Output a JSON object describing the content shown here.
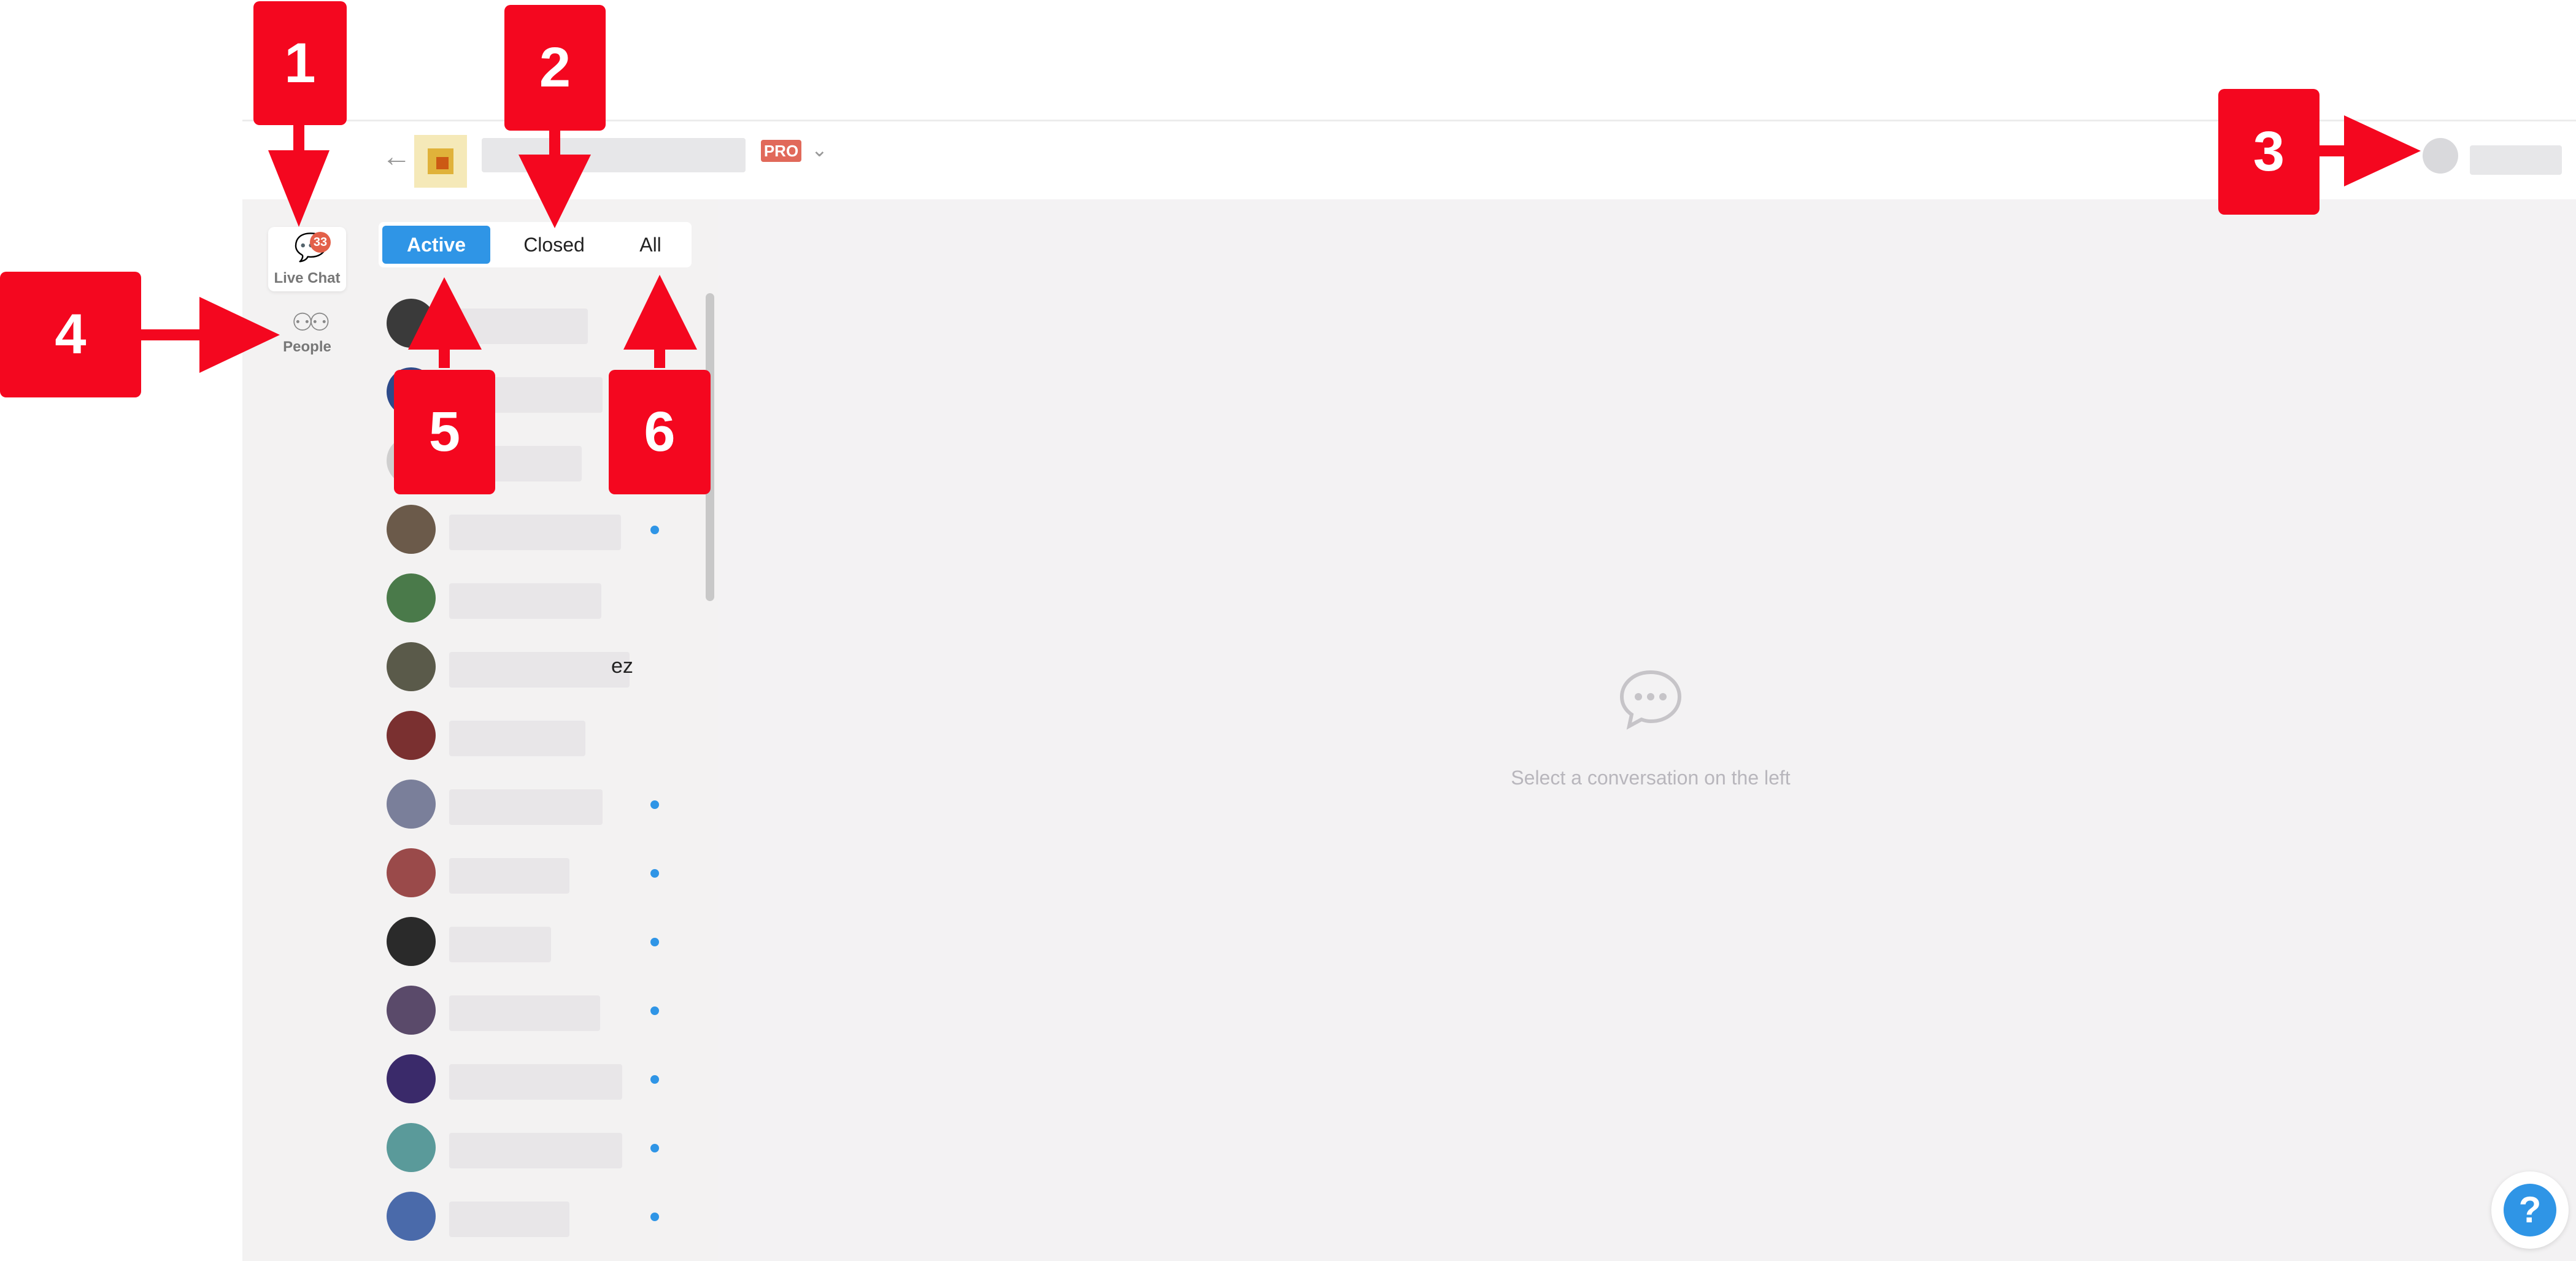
{
  "header": {
    "pro_badge": "PRO"
  },
  "nav": {
    "live_chat_label": "Live Chat",
    "live_chat_badge": "33",
    "people_label": "People"
  },
  "tabs": {
    "active": "Active",
    "closed": "Closed",
    "all": "All"
  },
  "conversations": [
    {
      "unread": false,
      "suffix": ""
    },
    {
      "unread": false,
      "suffix": ""
    },
    {
      "unread": false,
      "suffix": ""
    },
    {
      "unread": true,
      "suffix": ""
    },
    {
      "unread": false,
      "suffix": ""
    },
    {
      "unread": false,
      "suffix": "ez"
    },
    {
      "unread": false,
      "suffix": ""
    },
    {
      "unread": true,
      "suffix": ""
    },
    {
      "unread": true,
      "suffix": ""
    },
    {
      "unread": true,
      "suffix": ""
    },
    {
      "unread": true,
      "suffix": ""
    },
    {
      "unread": true,
      "suffix": ""
    },
    {
      "unread": true,
      "suffix": ""
    },
    {
      "unread": true,
      "suffix": ""
    }
  ],
  "main": {
    "empty_text": "Select a conversation on the left"
  },
  "help": {
    "label": "?"
  },
  "annotations": {
    "n1": "1",
    "n2": "2",
    "n3": "3",
    "n4": "4",
    "n5": "5",
    "n6": "6"
  },
  "colors": {
    "accent": "#2f95e6",
    "badge": "#e36049",
    "pro": "#e1695a",
    "callout": "#f4071f"
  }
}
